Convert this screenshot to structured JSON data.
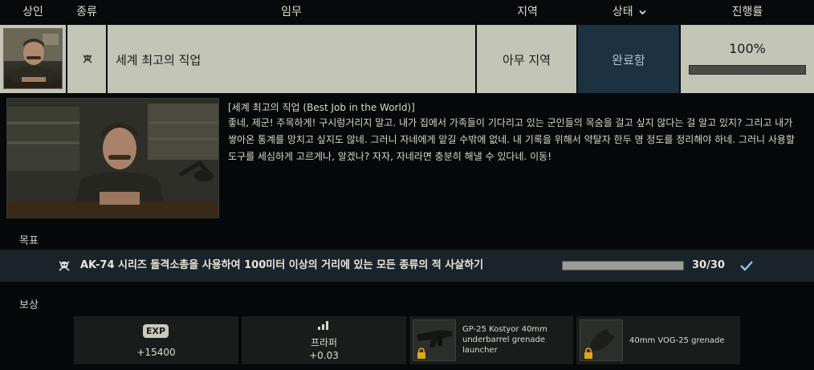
{
  "header": {
    "col_trader": "상인",
    "col_type": "종류",
    "col_task": "임무",
    "col_location": "지역",
    "col_status": "상태",
    "col_progress": "진행률"
  },
  "task": {
    "type_icon": "skull-icon",
    "name": "세계 최고의 직업",
    "location": "아무 지역",
    "status": "완료함",
    "progress_text": "100%",
    "progress": 1.0
  },
  "description": {
    "title": "[세계 최고의 직업 (Best Job in the World)]",
    "body": "좋네, 제군! 주목하게! 구시렁거리지 말고. 내가 집에서 가족들이 기다리고 있는 군인들의 목숨을 걸고 싶지 않다는 걸 알고 있지? 그리고 내가 쌓아온 통계를 망치고 싶지도 않네. 그러니 자네에게 맡길 수밖에 없네. 내 기록을 위해서 약탈자 한두 명 정도를 정리해야 하네. 그러니 사용할 도구를 세심하게 고르게나, 알겠나? 자자, 자네라면 충분히 해낼 수 있다네. 이동!"
  },
  "objectives": {
    "label": "목표",
    "items": [
      {
        "icon": "skull-icon",
        "text": "AK-74 시리즈 돌격소총을 사용하여 100미터 이상의 거리에 있는 모든 종류의 적 사살하기",
        "count": "30/30",
        "progress": 1.0,
        "done_icon": "checkmark-icon"
      }
    ]
  },
  "rewards": {
    "label": "보상",
    "exp_badge": "EXP",
    "exp_value": "+15400",
    "rep_label": "프라퍼",
    "rep_value": "+0.03",
    "items": [
      {
        "name": "GP-25 Kostyor 40mm underbarrel grenade launcher",
        "locked": true
      },
      {
        "name": "40mm VOG-25 grenade",
        "locked": true
      }
    ]
  },
  "colors": {
    "row_bg": "#c3c5b7",
    "status_bg": "#1d3240",
    "status_text": "#a9c4d4",
    "check": "#8fc6e8"
  }
}
